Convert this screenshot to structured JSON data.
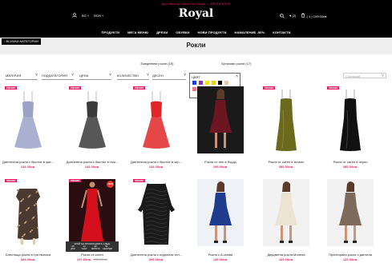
{
  "header": {
    "promo": "Доставка до офис на Спиди — БЕЗПЛАТНА",
    "logo": "Royal",
    "lang": "BG",
    "currency": "BGN",
    "wishlist_count": "(2)",
    "cart": "( 1 ) 109.00лв.",
    "nav": [
      "ПРОДУКТИ",
      "МЕГА МЕНЮ",
      "ДРЕХИ",
      "ОБУВКИ",
      "НОВИ ПРОДУКТИ",
      "НАМАЛЕНИЕ -50%",
      "КОНТАКТИ"
    ]
  },
  "back_button": "ВСИЧКИ КАТЕГОРИИ",
  "page_title": "Рокли",
  "subcategories": [
    "Ежедневни рокли (15)",
    "Бутикови рокли (17)"
  ],
  "filters": {
    "items": [
      "МАТЕРИЯ",
      "ПОДКАТЕГОРИЯ",
      "ЦЕНА",
      "КОЛИЧЕСТВО",
      "ДЕСЕН"
    ],
    "color_label": "ЦВЯТ",
    "sort_placeholder": "Сортирай"
  },
  "swatches": [
    "#1b3fd0",
    "#7b3fa0",
    "#f2e21c",
    "#e8cc2a",
    "#000000",
    "#e6c9a8",
    "#e97b8e",
    "#6a2c8e"
  ],
  "badges": {
    "promo": "PROMO",
    "pct": "-50%"
  },
  "countdown": {
    "title": "КРАЙ НА ПРОМОЦИЯТА СЛЕД:",
    "cells": [
      {
        "num": "00",
        "unit": "ДНИ"
      },
      {
        "num": "13",
        "unit": "ЧАСА"
      },
      {
        "num": "22",
        "unit": "МИНУТИ"
      },
      {
        "num": "51",
        "unit": "СЕКУНДИ"
      }
    ]
  },
  "products": [
    {
      "name": "Дантелена рокля с бюстие в цве...",
      "price": "134.00лв.",
      "old": "",
      "promo": true,
      "pct": false,
      "dress": "lace",
      "color": "#9aa2c8",
      "bg": "#ffffff"
    },
    {
      "name": "Дантелена рокля с бюстие в тъм...",
      "price": "134.00лв.",
      "old": "",
      "promo": true,
      "pct": false,
      "dress": "lace",
      "color": "#3a3a3a",
      "bg": "#ffffff"
    },
    {
      "name": "Дантелена рокля с бюстие в чер...",
      "price": "134.00лв.",
      "old": "",
      "promo": true,
      "pct": false,
      "dress": "lace",
      "color": "#e02626",
      "bg": "#ffffff"
    },
    {
      "name": "Рокля от тюл в бордо",
      "price": "199.00лв.",
      "old": "",
      "promo": false,
      "pct": false,
      "dress": "model",
      "color": "#6b1620",
      "bg": "#1a1a1a"
    },
    {
      "name": "Рокля от сатен в зелено",
      "price": "395.00лв.",
      "old": "",
      "promo": true,
      "pct": false,
      "dress": "slip",
      "color": "#6b6a1c",
      "bg": "#ffffff"
    },
    {
      "name": "Рокля от сатен в черно",
      "price": "395.00лв.",
      "old": "",
      "promo": true,
      "pct": false,
      "dress": "slip",
      "color": "#111111",
      "bg": "#ffffff"
    },
    {
      "name": "Блестяща рокля в три нюанса",
      "price": "334.00лв.",
      "old": "",
      "promo": true,
      "pct": false,
      "dress": "sequin",
      "color": "#4a3a32",
      "bg": "#ffffff"
    },
    {
      "name": "Рокля от сатен",
      "price": "197.65лв.",
      "old": "395.00лв.",
      "promo": true,
      "pct": true,
      "dress": "red",
      "color": "#d4101c",
      "bg": "#2a0d10"
    },
    {
      "name": "Дантелена рокля с подплата тел...",
      "price": "395.00лв.",
      "old": "",
      "promo": true,
      "pct": false,
      "dress": "lacelong",
      "color": "#1a1a1a",
      "bg": "#ffffff"
    },
    {
      "name": "Рокля с А-линия",
      "price": "149.00лв.",
      "old": "",
      "promo": false,
      "pct": false,
      "dress": "model",
      "color": "#1e3b8e",
      "bg": "#eef2f6"
    },
    {
      "name": "Двуцветна рокля Монена",
      "price": "169.00лв.",
      "old": "",
      "promo": false,
      "pct": false,
      "dress": "model",
      "color": "#ece4d2",
      "bg": "#f2f2f2"
    },
    {
      "name": "Принтирана рокля с дантела",
      "price": "120.00лв.",
      "old": "",
      "promo": false,
      "pct": false,
      "dress": "model",
      "color": "#7d6a5a",
      "bg": "#f2f2f2"
    }
  ]
}
